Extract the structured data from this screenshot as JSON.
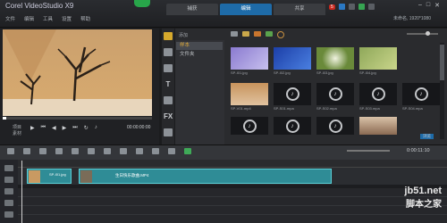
{
  "app": {
    "logo_text": "Corel VideoStudio X9",
    "menu": [
      "文件",
      "编辑",
      "工具",
      "设置",
      "帮助"
    ],
    "status": "未命名, 1920*1080"
  },
  "tabs": [
    {
      "label": "捕获",
      "active": false
    },
    {
      "label": "编辑",
      "active": true
    },
    {
      "label": "共享",
      "active": false
    }
  ],
  "tray": {
    "badge": "5"
  },
  "preview": {
    "project_label": "项目",
    "clip_label": "素材",
    "timecode": "00:00:00:00"
  },
  "library": {
    "add_folder": "添加",
    "folders": [
      {
        "label": "样本",
        "selected": true
      },
      {
        "label": "文件夹",
        "selected": false
      }
    ],
    "thumbs": [
      {
        "caption": "SP-I01.jpg",
        "kind": "purple"
      },
      {
        "caption": "SP-I02.jpg",
        "kind": "blue"
      },
      {
        "caption": "SP-I03.jpg",
        "kind": "dandelion"
      },
      {
        "caption": "SP-I04.jpg",
        "kind": "green"
      },
      {
        "caption": "SP-V01.mp4",
        "kind": "desert"
      },
      {
        "caption": "SP-S01.mpa",
        "kind": "audio"
      },
      {
        "caption": "SP-S02.mpa",
        "kind": "audio"
      },
      {
        "caption": "SP-S03.mpa",
        "kind": "audio"
      },
      {
        "caption": "SP-S04.mpa",
        "kind": "audio"
      },
      {
        "caption": "SP-S05.mpa",
        "kind": "audio"
      },
      {
        "caption": "SP-S06.mpa",
        "kind": "audio"
      },
      {
        "caption": "SP-S07.mpa",
        "kind": "audio"
      },
      {
        "caption": "SP-I05.jpg",
        "kind": "face"
      }
    ],
    "browse_label": "浏览"
  },
  "timeline": {
    "timecode": "0:00:11:10",
    "clips": [
      {
        "label": "SP-I01.jpg"
      },
      {
        "label": "生日快乐歌曲.MP4"
      }
    ]
  },
  "watermark": {
    "line1": "jb51.net",
    "line2": "脚本之家"
  }
}
